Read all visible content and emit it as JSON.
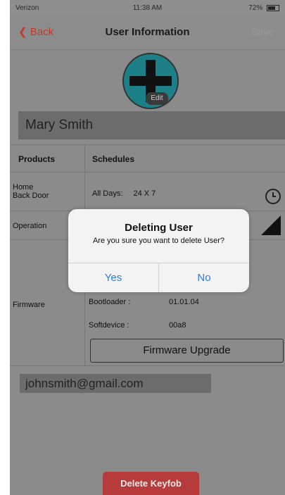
{
  "status_bar": {
    "carrier": "Verizon",
    "time": "11:38 AM",
    "battery": "72%"
  },
  "nav": {
    "back_label": "Back",
    "title": "User Information",
    "save_label": "Save"
  },
  "avatar": {
    "edit_label": "Edit",
    "color": "#1d7f87"
  },
  "user": {
    "name": "Mary Smith",
    "email": "johnsmith@gmail.com"
  },
  "table": {
    "products_header": "Products",
    "schedules_header": "Schedules",
    "home_product": "Home\nBack Door",
    "all_days_label": "All Days:",
    "all_days_value": "24 X 7",
    "operation_label": "Operation",
    "firmware_label": "Firmware",
    "bootloader_label": "Bootloader :",
    "bootloader_value": "01.01.04",
    "softdevice_label": "Softdevice :",
    "softdevice_value": "00a8",
    "firmware_upgrade_label": "Firmware Upgrade"
  },
  "delete_button_label": "Delete Keyfob",
  "dialog": {
    "title": "Deleting User",
    "message": "Are you sure you want to delete User?",
    "yes_label": "Yes",
    "no_label": "No"
  },
  "colors": {
    "accent_red": "#c0392b",
    "link_blue": "#2f79e8",
    "delete_red": "#b83b3b"
  }
}
